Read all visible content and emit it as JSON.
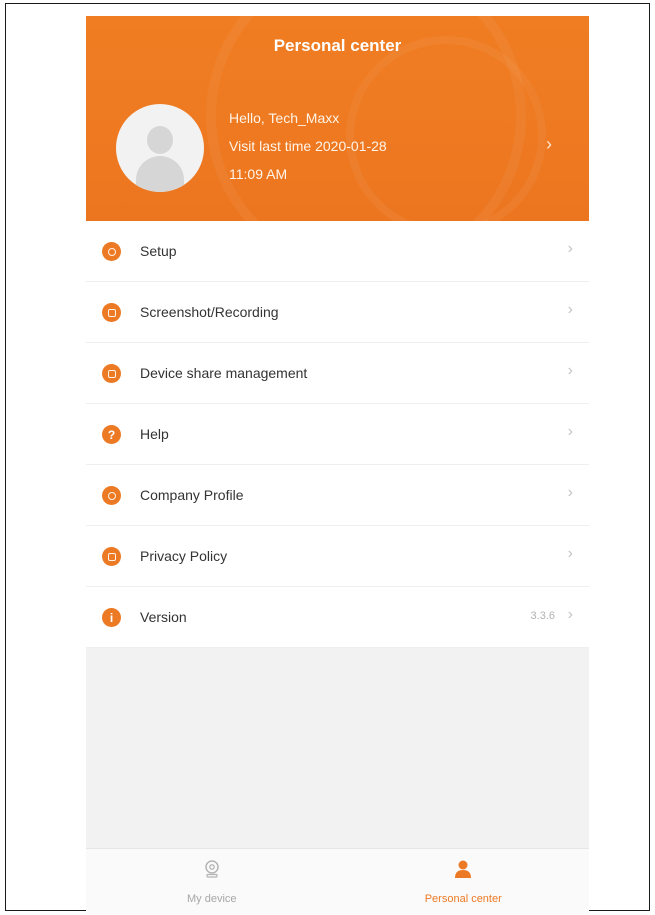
{
  "header": {
    "title": "Personal center",
    "greeting": "Hello, Tech_Maxx",
    "visit_line": "Visit last time 2020-01-28",
    "visit_time": "11:09 AM",
    "chevron": "›"
  },
  "menu": {
    "items": [
      {
        "label": "Setup",
        "icon": "gear-icon",
        "chevron": "›"
      },
      {
        "label": "Screenshot/Recording",
        "icon": "camera-icon",
        "chevron": "›"
      },
      {
        "label": "Device share management",
        "icon": "share-icon",
        "chevron": "›"
      },
      {
        "label": "Help",
        "icon": "help-icon",
        "glyph": "?",
        "chevron": "›"
      },
      {
        "label": "Company Profile",
        "icon": "company-icon",
        "chevron": "›"
      },
      {
        "label": "Privacy Policy",
        "icon": "privacy-icon",
        "chevron": "›"
      },
      {
        "label": "Version",
        "icon": "info-icon",
        "glyph": "i",
        "value": "3.3.6",
        "chevron": "›"
      }
    ]
  },
  "tabbar": {
    "tabs": [
      {
        "label": "My device",
        "icon": "camera-device-icon",
        "active": false
      },
      {
        "label": "Personal center",
        "icon": "person-icon",
        "active": true
      }
    ]
  },
  "colors": {
    "accent": "#ec7a25",
    "background": "#f2f2f2"
  }
}
